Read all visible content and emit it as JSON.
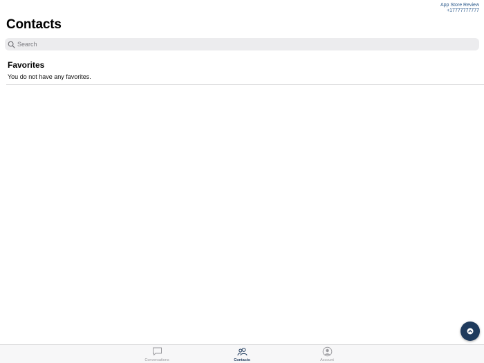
{
  "account": {
    "name": "App Store Review",
    "phone": "+17777777777"
  },
  "header": {
    "title": "Contacts"
  },
  "search": {
    "placeholder": "Search",
    "value": ""
  },
  "favorites": {
    "title": "Favorites",
    "empty_message": "You do not have any favorites."
  },
  "fab": {
    "icon": "chevron-up-icon"
  },
  "tabs": [
    {
      "label": "Conversations",
      "icon": "chat-bubble-icon",
      "active": false
    },
    {
      "label": "Contacts",
      "icon": "people-icon",
      "active": true
    },
    {
      "label": "Account",
      "icon": "user-circle-icon",
      "active": false
    }
  ],
  "colors": {
    "accent": "#1e3a5c",
    "account_text": "#2c5a8c",
    "search_bg": "#ececee",
    "inactive_tab": "#9a9a9e"
  }
}
